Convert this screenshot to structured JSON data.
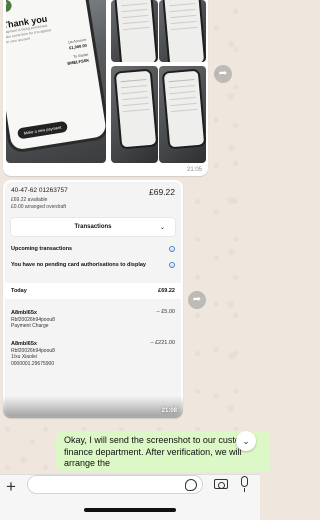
{
  "image_message": {
    "receipt": {
      "heading": "Thank you",
      "line1": "payment is being processed.",
      "line2": "take some time for it to appear",
      "line3": "on your account",
      "label1": "1st Account",
      "value1": "€1,000.00",
      "label2": "To Xiaolei",
      "value2": "BMELFSSK",
      "button": "Make a new payment"
    },
    "time": "21:05"
  },
  "bank_screenshot": {
    "account_number": "40-47-62 01263757",
    "balance": "£69.22",
    "available": "£69.22 available",
    "overdraft": "£0.00 arranged overdraft",
    "dropdown_label": "Transactions",
    "upcoming_title": "Upcoming transactions",
    "pending_text": "You have no pending card authorisations to display",
    "today_label": "Today",
    "today_amount": "£69.22",
    "transactions": [
      {
        "title": "A8mbl65x",
        "lines": [
          "Rbf20026h94poou8",
          "Payment Charge"
        ],
        "amount": "– £5.00"
      },
      {
        "title": "A8mbl65x",
        "lines": [
          "Rbf20026h94poou8",
          "1/xu Xiaolei",
          "0000001.29675900"
        ],
        "amount": "– £221.00"
      }
    ],
    "time": "21:08"
  },
  "outgoing_message": {
    "text": "Okay, I will send the screenshot to our customs finance department. After verification, we will arrange the"
  },
  "icons": {
    "forward": "forward-icon",
    "scroll_down": "chevron-down-icon",
    "plus": "plus-icon",
    "sticker": "sticker-icon",
    "camera": "camera-icon",
    "mic": "mic-icon"
  },
  "colors": {
    "chat_background": "#efe7de",
    "outgoing_bubble": "#dcf8c6",
    "incoming_bubble": "#ffffff"
  }
}
